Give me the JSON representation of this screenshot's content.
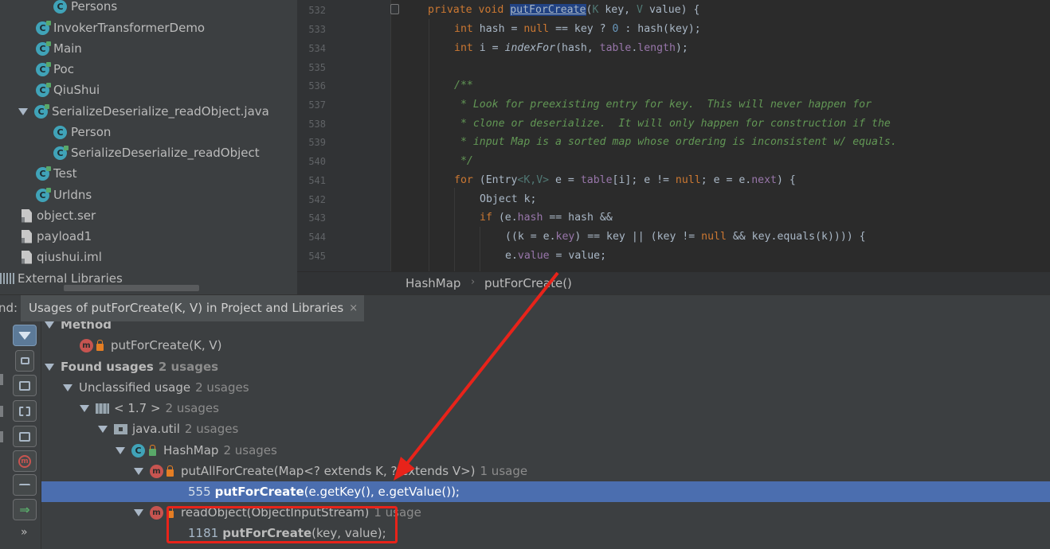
{
  "project_tree": {
    "items": [
      {
        "label": "Persons"
      },
      {
        "label": "InvokerTransformerDemo"
      },
      {
        "label": "Main"
      },
      {
        "label": "Poc"
      },
      {
        "label": "QiuShui"
      },
      {
        "label": "SerializeDeserialize_readObject.java"
      },
      {
        "label": "Person"
      },
      {
        "label": "SerializeDeserialize_readObject"
      },
      {
        "label": "Test"
      },
      {
        "label": "Urldns"
      },
      {
        "label": "object.ser"
      },
      {
        "label": "payload1"
      },
      {
        "label": "qiushui.iml"
      },
      {
        "label": "External Libraries"
      }
    ]
  },
  "editor": {
    "line_numbers": [
      "532",
      "533",
      "534",
      "535",
      "536",
      "537",
      "538",
      "539",
      "540",
      "541",
      "542",
      "543",
      "544",
      "545"
    ],
    "code": {
      "l532": {
        "kw1": "private void ",
        "method": "putForCreate",
        "p1": "(",
        "t1": "K",
        "p2": " key, ",
        "t2": "V",
        "p3": " value) {"
      },
      "l533": {
        "kw": "int",
        "a": " hash = ",
        "nul": "null",
        "b": " == key ? ",
        "zero": "0",
        "c": " : hash(key);"
      },
      "l534": {
        "kw": "int",
        "a": " i = ",
        "fn": "indexFor",
        "b": "(hash, ",
        "f": "table",
        "c": ".",
        "f2": "length",
        "d": ");"
      },
      "l536": "/**",
      "l537": " * Look for preexisting entry for key.  This will never happen for",
      "l538": " * clone or deserialize.  It will only happen for construction if the",
      "l539": " * input Map is a sorted map whose ordering is inconsistent w/ equals.",
      "l540": " */",
      "l541": {
        "kw": "for",
        "a": " (Entry",
        "t": "<K,V>",
        "b": " e = ",
        "f": "table",
        "c": "[i]; e != ",
        "nul": "null",
        "d": "; e = e.",
        "f2": "next",
        "e": ") {"
      },
      "l542": "Object k;",
      "l543": {
        "kw": "if",
        "a": " (e.",
        "f": "hash",
        "b": " == hash &&"
      },
      "l544": {
        "a": "((k = e.",
        "f": "key",
        "b": ") == key || (key != ",
        "nul": "null",
        "c": " && key.equals(k)))) {"
      },
      "l545": {
        "a": "e.",
        "f": "value",
        "b": " = value;"
      }
    }
  },
  "breadcrumb": {
    "items": [
      "HashMap",
      "putForCreate()"
    ],
    "separator": "›"
  },
  "find_panel": {
    "label": "nd:",
    "tab_title": "Usages of putForCreate(K, V) in Project and Libraries",
    "close_glyph": "×",
    "more_glyph": "»",
    "tree": {
      "method_header": "Method",
      "method_signature": "putForCreate(K, V)",
      "found_usages": "Found usages",
      "found_count": "2 usages",
      "unclassified": "Unclassified usage",
      "unclassified_count": "2 usages",
      "jdk": "< 1.7 >",
      "jdk_count": "2 usages",
      "package": "java.util",
      "package_count": "2 usages",
      "class": "HashMap",
      "class_count": "2 usages",
      "method1": "putAllForCreate(Map<? extends K, ? extends V>)",
      "method1_count": "1 usage",
      "usage1_line": "555",
      "usage1_call": "putForCreate",
      "usage1_args": "(e.getKey(), e.getValue());",
      "method2": "readObject(ObjectInputStream)",
      "method2_count": "1 usage",
      "usage2_line": "1181",
      "usage2_call": "putForCreate",
      "usage2_args": "(key, value);"
    }
  },
  "icons": {
    "class_icon_letter": "C",
    "method_icon_letter": "m"
  },
  "colors": {
    "selection": "#4b6eaf",
    "annotation_red": "#e8231a",
    "keyword": "#cc7832",
    "comment": "#629755",
    "field": "#9876aa",
    "number": "#6897bb",
    "class_icon": "#40a3b8",
    "method_icon": "#c75450"
  }
}
